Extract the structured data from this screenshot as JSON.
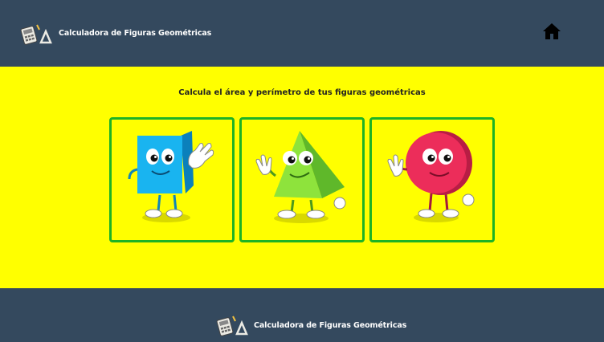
{
  "header": {
    "app_title": "Calculadora de Figuras Geométricas",
    "logo_icon": "calculator-ruler-icon",
    "home_icon": "home-icon"
  },
  "main": {
    "subtitle": "Calcula el área y perímetro de tus figuras geométricas",
    "cards": [
      {
        "shape": "square",
        "icon": "square-character-icon",
        "color": "#19b4f0"
      },
      {
        "shape": "triangle",
        "icon": "triangle-character-icon",
        "color": "#8ee33c"
      },
      {
        "shape": "circle",
        "icon": "circle-character-icon",
        "color": "#ec2d5a"
      }
    ]
  },
  "footer": {
    "app_title": "Calculadora de Figuras Geométricas",
    "logo_icon": "calculator-ruler-icon"
  },
  "colors": {
    "bar": "#34495e",
    "background": "#ffff00",
    "card_border": "#1db325"
  }
}
